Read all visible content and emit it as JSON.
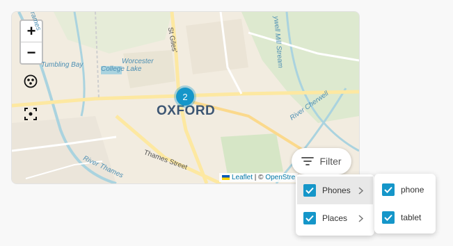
{
  "map": {
    "city_label": "OXFORD",
    "cluster_count": "2",
    "zoom_in": "+",
    "zoom_out": "−",
    "place_labels": {
      "worcester": "Worcester",
      "college_lake": "College Lake",
      "tumbling_bay": "Tumbling Bay",
      "river_thames": "River Thames",
      "river_cherwell": "River Cherwell",
      "mill_stream": "ywell Mill Stream",
      "trames": "rames"
    },
    "road_labels": {
      "st_giles": "St Giles'",
      "thames_street": "Thames Street"
    },
    "attribution": {
      "leaflet": "Leaflet",
      "separator": " | © ",
      "osm": "OpenStre"
    }
  },
  "filter": {
    "label": "Filter",
    "menu": [
      {
        "label": "Phones",
        "checked": true,
        "has_submenu": true
      },
      {
        "label": "Places",
        "checked": true,
        "has_submenu": true
      }
    ],
    "submenu": [
      {
        "label": "phone",
        "checked": true
      },
      {
        "label": "tablet",
        "checked": true
      }
    ]
  },
  "colors": {
    "accent": "#1596c9",
    "city": "#3d5673",
    "water_label": "#4d8fb3"
  }
}
